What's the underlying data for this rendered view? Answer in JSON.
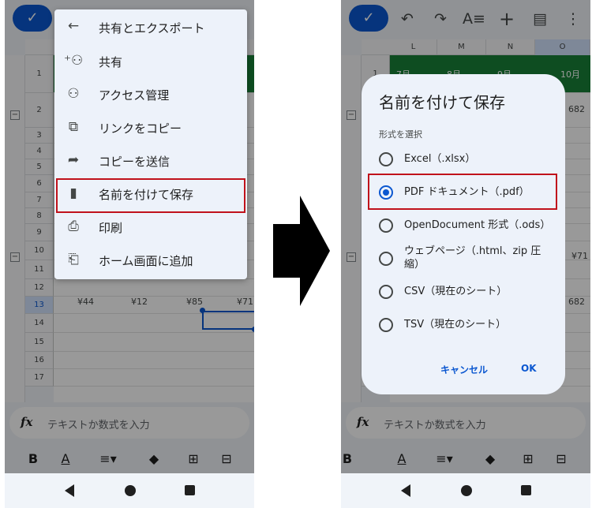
{
  "left": {
    "check_icon": "check-icon",
    "rows": [
      "1",
      "2",
      "3",
      "4",
      "5",
      "6",
      "7",
      "8",
      "9",
      "10",
      "11",
      "12",
      "13",
      "14",
      "15",
      "16",
      "17"
    ],
    "yen_values": [
      "¥44",
      "¥12",
      "¥85",
      "¥71"
    ],
    "menu": {
      "header": "共有とエクスポート",
      "items": [
        {
          "label": "共有",
          "icon": "add-person-icon"
        },
        {
          "label": "アクセス管理",
          "icon": "people-icon"
        },
        {
          "label": "リンクをコピー",
          "icon": "copy-icon"
        },
        {
          "label": "コピーを送信",
          "icon": "share-arrow-icon"
        },
        {
          "label": "名前を付けて保存",
          "icon": "file-icon"
        },
        {
          "label": "印刷",
          "icon": "print-icon"
        },
        {
          "label": "ホーム画面に追加",
          "icon": "add-to-home-icon"
        }
      ]
    },
    "formula_placeholder": "テキストか数式を入力"
  },
  "right": {
    "columns": [
      "L",
      "M",
      "N",
      "O"
    ],
    "band_text": [
      "7月",
      "8月",
      "9月",
      "10月"
    ],
    "peek_values": [
      "682",
      "¥71",
      "682"
    ],
    "dialog": {
      "title": "名前を付けて保存",
      "subtitle": "形式を選択",
      "options": [
        {
          "label": "Excel（.xlsx）",
          "selected": false
        },
        {
          "label": "PDF ドキュメント（.pdf）",
          "selected": true
        },
        {
          "label": "OpenDocument 形式（.ods）",
          "selected": false
        },
        {
          "label": "ウェブページ（.html、zip 圧縮）",
          "selected": false
        },
        {
          "label": "CSV（現在のシート）",
          "selected": false
        },
        {
          "label": "TSV（現在のシート）",
          "selected": false
        }
      ],
      "cancel": "キャンセル",
      "ok": "OK"
    },
    "formula_placeholder": "テキストか数式を入力"
  },
  "formatting": [
    "B",
    "A"
  ],
  "colors": {
    "accent": "#0b57d0",
    "highlight": "#c0121b",
    "band": "#188038"
  }
}
